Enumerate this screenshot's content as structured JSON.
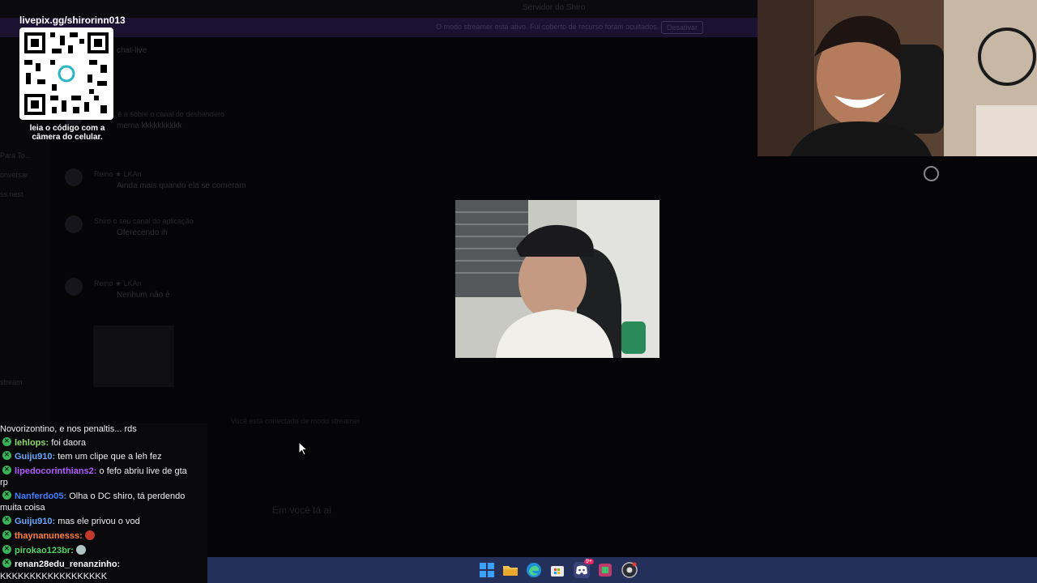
{
  "background": {
    "server_title": "Servidor do Shiro",
    "banner_text": "O modo streamer está ativo. Fui coberto de recurso foram ocultados.",
    "banner_button": "Desativar",
    "channel_label": "chat-live",
    "sidebar_items": [
      "Para To...",
      "onversar",
      "ss nest",
      "stream"
    ],
    "messages": [
      {
        "line1": "Vaildo, é a sobre o canal do desbandero",
        "line2": "mema kkkkkkkkkk"
      },
      {
        "line1": "Reino ★ LKAn",
        "line2": "Ainda mais quando ela se comeram"
      },
      {
        "line1": "Shiro o seu canal do aplicação",
        "line2": "Oferecendo ih"
      },
      {
        "line1": "Reino ★ LKAn",
        "line2": "Nenhum não é"
      }
    ],
    "center_text": "Você está conectado de modo streamer",
    "footer_text": "Em você tá aí"
  },
  "overlay": {
    "qr_url": "livepix.gg/shirorinn013",
    "qr_caption_line1": "leia o código com a",
    "qr_caption_line2": "câmera do celular."
  },
  "chat": {
    "lines": [
      {
        "user": "",
        "text": "Novorizontino, e nos penaltis... rds",
        "color": "#ffffff"
      },
      {
        "user": "lehlops:",
        "text": "foi daora",
        "color": "#8fd86a"
      },
      {
        "user": "Guiju910:",
        "text": "tem um clipe que a leh fez",
        "color": "#6aa7ff"
      },
      {
        "user": "lipedocorinthians2:",
        "text": "o fefo abriu live de gta",
        "continuation": "rp",
        "color": "#b35cff"
      },
      {
        "user": "Nanferdo05:",
        "text": "Olha o DC shiro, tá perdendo",
        "continuation": "muita coisa",
        "color": "#3f7fff"
      },
      {
        "user": "Guiju910:",
        "text": "mas ele privou o vod",
        "color": "#6aa7ff"
      },
      {
        "user": "thaynanunesss:",
        "text": "",
        "emote": "#c0392b",
        "color": "#ff7f3f"
      },
      {
        "user": "pirokao123br:",
        "text": "",
        "emote": "#b0c4c4",
        "color": "#4fd46a"
      },
      {
        "user": "renan28edu_renanzinho:",
        "text": "",
        "continuation": "KKKKKKKKKKKKKKKKKK",
        "color": "#ffffff"
      }
    ]
  },
  "taskbar": {
    "icons": [
      "windows-start-icon",
      "file-explorer-icon",
      "edge-browser-icon",
      "microsoft-store-icon",
      "discord-icon",
      "app-green-icon",
      "chrome-icon"
    ],
    "discord_badge": "9+"
  }
}
